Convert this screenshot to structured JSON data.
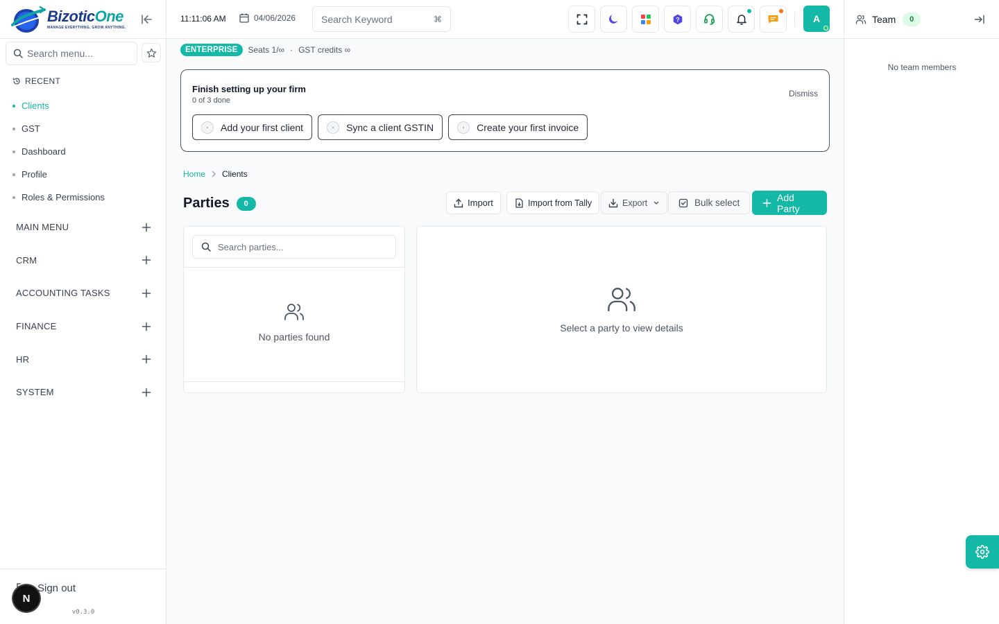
{
  "app": {
    "brand_name": "BizoticOne",
    "brand_name_main": "Bizotic",
    "brand_name_accent": "One",
    "tagline": "MANAGE EVERYTHING, GROW ANYTHING.",
    "version": "v0.3.0",
    "colors": {
      "accent": "#14b8a6",
      "brand_blue": "#1e3a8a",
      "success": "#22c55e"
    }
  },
  "sidebar": {
    "search_placeholder": "Search menu...",
    "recent_heading": "RECENT",
    "recent_items": [
      {
        "label": "Clients",
        "active": true
      },
      {
        "label": "GST",
        "active": false
      },
      {
        "label": "Dashboard",
        "active": false
      },
      {
        "label": "Profile",
        "active": false
      },
      {
        "label": "Roles & Permissions",
        "active": false
      }
    ],
    "sections": [
      {
        "label": "MAIN MENU"
      },
      {
        "label": "CRM"
      },
      {
        "label": "ACCOUNTING TASKS"
      },
      {
        "label": "FINANCE"
      },
      {
        "label": "HR"
      },
      {
        "label": "SYSTEM"
      }
    ],
    "signout_label": "Sign out",
    "floating_badge": "N"
  },
  "topbar": {
    "time": "11:11:06 AM",
    "date": "04/06/2026",
    "search_placeholder": "Search Keyword",
    "search_shortcut": "⌘",
    "icons": [
      "fullscreen-icon",
      "moon-icon",
      "apps-grid-icon",
      "help-hexagon-icon",
      "headset-icon",
      "bell-icon",
      "chat-icon"
    ],
    "avatar_initial": "A"
  },
  "plan": {
    "badge": "ENTERPRISE",
    "seats": "Seats 1/∞",
    "separator": "·",
    "gst_credits": "GST credits ∞"
  },
  "setup": {
    "title": "Finish setting up your firm",
    "progress": "0 of 3 done",
    "dismiss_label": "Dismiss",
    "steps": [
      {
        "label": "Add your first client"
      },
      {
        "label": "Sync a client GSTIN"
      },
      {
        "label": "Create your first invoice"
      }
    ]
  },
  "breadcrumb": {
    "home": "Home",
    "current": "Clients"
  },
  "parties": {
    "title": "Parties",
    "count": "0",
    "actions": {
      "import": "Import",
      "import_tally": "Import from Tally",
      "export": "Export",
      "bulk_select": "Bulk select",
      "add_party": "Add Party"
    },
    "search_placeholder": "Search parties...",
    "empty_list": "No parties found",
    "empty_detail": "Select a party to view details"
  },
  "team_panel": {
    "title": "Team",
    "count": "0",
    "empty": "No team members"
  }
}
